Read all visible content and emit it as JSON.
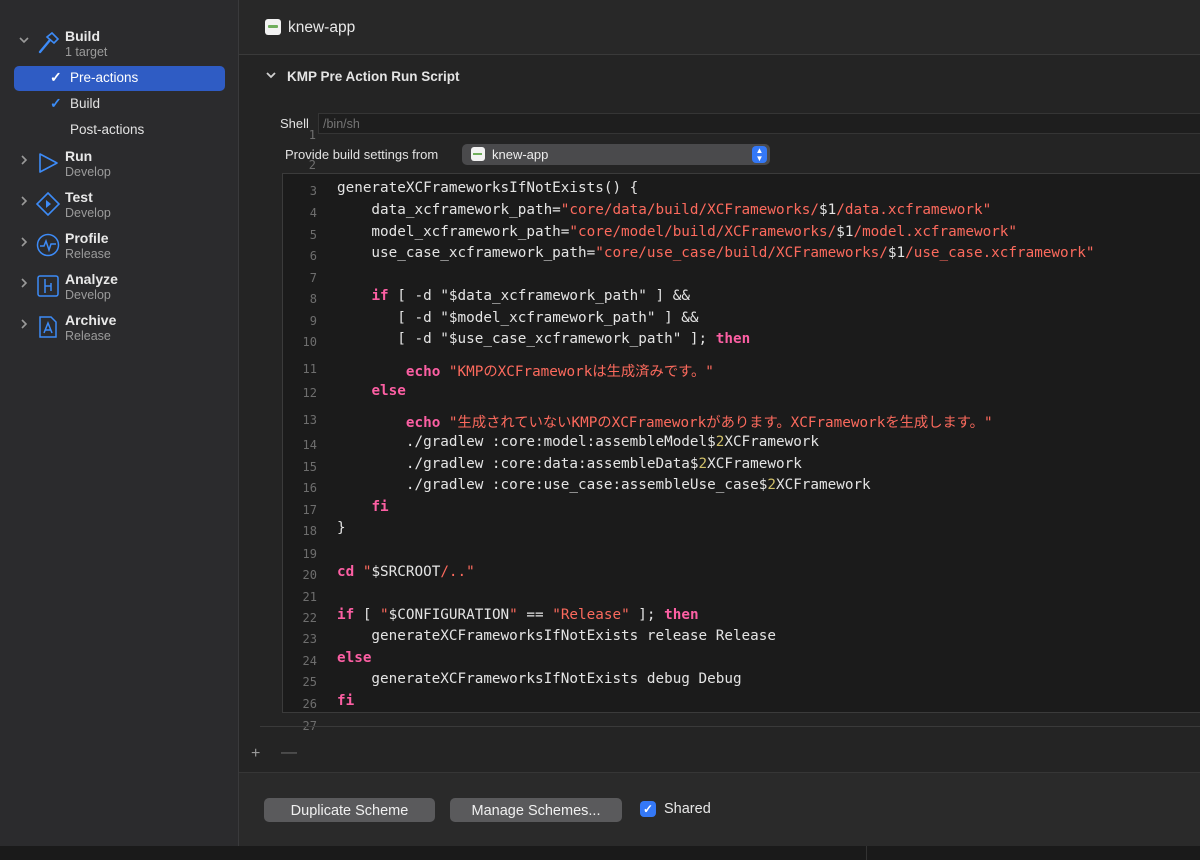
{
  "sidebar": {
    "phases": [
      {
        "name": "Build",
        "sub": "1 target",
        "expanded": true,
        "icon": "hammer-icon"
      },
      {
        "name": "Run",
        "sub": "Develop",
        "expanded": false,
        "icon": "play-icon"
      },
      {
        "name": "Test",
        "sub": "Develop",
        "expanded": false,
        "icon": "diamond-play-icon"
      },
      {
        "name": "Profile",
        "sub": "Release",
        "expanded": false,
        "icon": "waveform-icon"
      },
      {
        "name": "Analyze",
        "sub": "Develop",
        "expanded": false,
        "icon": "analyze-icon"
      },
      {
        "name": "Archive",
        "sub": "Release",
        "expanded": false,
        "icon": "archive-icon"
      }
    ],
    "build_items": [
      {
        "label": "Pre-actions",
        "checked": true,
        "selected": true
      },
      {
        "label": "Build",
        "checked": true,
        "selected": false
      },
      {
        "label": "Post-actions",
        "checked": false,
        "selected": false
      }
    ]
  },
  "header": {
    "title": "knew-app",
    "icon": "app-icon"
  },
  "action": {
    "title": "KMP Pre Action Run Script",
    "shell_label": "Shell",
    "shell_placeholder": "/bin/sh",
    "build_settings_label": "Provide build settings from",
    "build_settings_value": "knew-app"
  },
  "code": [
    {
      "n": "1",
      "tokens": []
    },
    {
      "n": "2",
      "tokens": []
    },
    {
      "n": "3",
      "tokens": [
        {
          "t": "generateXCFrameworksIfNotExists() {",
          "c": ""
        }
      ]
    },
    {
      "n": "4",
      "tokens": [
        {
          "t": "    data_xcframework_path=",
          "c": ""
        },
        {
          "t": "\"core/data/build/XCFrameworks/",
          "c": "s"
        },
        {
          "t": "$1",
          "c": ""
        },
        {
          "t": "/data.xcframework\"",
          "c": "s"
        }
      ]
    },
    {
      "n": "5",
      "tokens": [
        {
          "t": "    model_xcframework_path=",
          "c": ""
        },
        {
          "t": "\"core/model/build/XCFrameworks/",
          "c": "s"
        },
        {
          "t": "$1",
          "c": ""
        },
        {
          "t": "/model.xcframework\"",
          "c": "s"
        }
      ]
    },
    {
      "n": "6",
      "tokens": [
        {
          "t": "    use_case_xcframework_path=",
          "c": ""
        },
        {
          "t": "\"core/use_case/build/XCFrameworks/",
          "c": "s"
        },
        {
          "t": "$1",
          "c": ""
        },
        {
          "t": "/use_case.xcframework\"",
          "c": "s"
        }
      ]
    },
    {
      "n": "7",
      "tokens": []
    },
    {
      "n": "8",
      "tokens": [
        {
          "t": "    ",
          "c": ""
        },
        {
          "t": "if",
          "c": "k"
        },
        {
          "t": " [ -d ",
          "c": ""
        },
        {
          "t": "\"$data_xcframework_path\"",
          "c": ""
        },
        {
          "t": " ] &&",
          "c": ""
        }
      ]
    },
    {
      "n": "9",
      "tokens": [
        {
          "t": "       [ -d ",
          "c": ""
        },
        {
          "t": "\"$model_xcframework_path\"",
          "c": ""
        },
        {
          "t": " ] &&",
          "c": ""
        }
      ]
    },
    {
      "n": "10",
      "tokens": [
        {
          "t": "       [ -d ",
          "c": ""
        },
        {
          "t": "\"$use_case_xcframework_path\"",
          "c": ""
        },
        {
          "t": " ]; ",
          "c": ""
        },
        {
          "t": "then",
          "c": "k"
        }
      ]
    },
    {
      "n": "11",
      "tokens": [
        {
          "t": "        ",
          "c": ""
        },
        {
          "t": "echo",
          "c": "k"
        },
        {
          "t": " ",
          "c": ""
        },
        {
          "t": "\"KMPのXCFrameworkは生成済みです。\"",
          "c": "s"
        }
      ]
    },
    {
      "n": "12",
      "tokens": [
        {
          "t": "    ",
          "c": ""
        },
        {
          "t": "else",
          "c": "k"
        }
      ]
    },
    {
      "n": "13",
      "tokens": [
        {
          "t": "        ",
          "c": ""
        },
        {
          "t": "echo",
          "c": "k"
        },
        {
          "t": " ",
          "c": ""
        },
        {
          "t": "\"生成されていないKMPのXCFrameworkがあります。XCFrameworkを生成します。\"",
          "c": "s"
        }
      ]
    },
    {
      "n": "14",
      "tokens": [
        {
          "t": "        ./gradlew :core:model:assembleModel$",
          "c": ""
        },
        {
          "t": "2",
          "c": "n"
        },
        {
          "t": "XCFramework",
          "c": ""
        }
      ]
    },
    {
      "n": "15",
      "tokens": [
        {
          "t": "        ./gradlew :core:data:assembleData$",
          "c": ""
        },
        {
          "t": "2",
          "c": "n"
        },
        {
          "t": "XCFramework",
          "c": ""
        }
      ]
    },
    {
      "n": "16",
      "tokens": [
        {
          "t": "        ./gradlew :core:use_case:assembleUse_case$",
          "c": ""
        },
        {
          "t": "2",
          "c": "n"
        },
        {
          "t": "XCFramework",
          "c": ""
        }
      ]
    },
    {
      "n": "17",
      "tokens": [
        {
          "t": "    ",
          "c": ""
        },
        {
          "t": "fi",
          "c": "k"
        }
      ]
    },
    {
      "n": "18",
      "tokens": [
        {
          "t": "}",
          "c": ""
        }
      ]
    },
    {
      "n": "19",
      "tokens": []
    },
    {
      "n": "20",
      "tokens": [
        {
          "t": "cd",
          "c": "k"
        },
        {
          "t": " ",
          "c": ""
        },
        {
          "t": "\"",
          "c": "s"
        },
        {
          "t": "$SRCROOT",
          "c": ""
        },
        {
          "t": "/..\"",
          "c": "s"
        }
      ]
    },
    {
      "n": "21",
      "tokens": []
    },
    {
      "n": "22",
      "tokens": [
        {
          "t": "if",
          "c": "k"
        },
        {
          "t": " [ ",
          "c": ""
        },
        {
          "t": "\"",
          "c": "s"
        },
        {
          "t": "$CONFIGURATION",
          "c": ""
        },
        {
          "t": "\"",
          "c": "s"
        },
        {
          "t": " == ",
          "c": ""
        },
        {
          "t": "\"Release\"",
          "c": "s"
        },
        {
          "t": " ]; ",
          "c": ""
        },
        {
          "t": "then",
          "c": "k"
        }
      ]
    },
    {
      "n": "23",
      "tokens": [
        {
          "t": "    generateXCFrameworksIfNotExists release Release",
          "c": ""
        }
      ]
    },
    {
      "n": "24",
      "tokens": [
        {
          "t": "else",
          "c": "k"
        }
      ]
    },
    {
      "n": "25",
      "tokens": [
        {
          "t": "    generateXCFrameworksIfNotExists debug Debug",
          "c": ""
        }
      ]
    },
    {
      "n": "26",
      "tokens": [
        {
          "t": "fi",
          "c": "k"
        }
      ]
    },
    {
      "n": "27",
      "tokens": []
    }
  ],
  "toolbar": {
    "add_label": "+",
    "remove_label": "—"
  },
  "footer": {
    "duplicate_label": "Duplicate Scheme",
    "manage_label": "Manage Schemes...",
    "shared_label": "Shared",
    "shared_checked": true
  },
  "colors": {
    "accent": "#3478f6",
    "selection": "#2f5cc4",
    "keyword": "#fc5fa3",
    "string": "#fc6a5d",
    "number": "#d0bf69"
  }
}
